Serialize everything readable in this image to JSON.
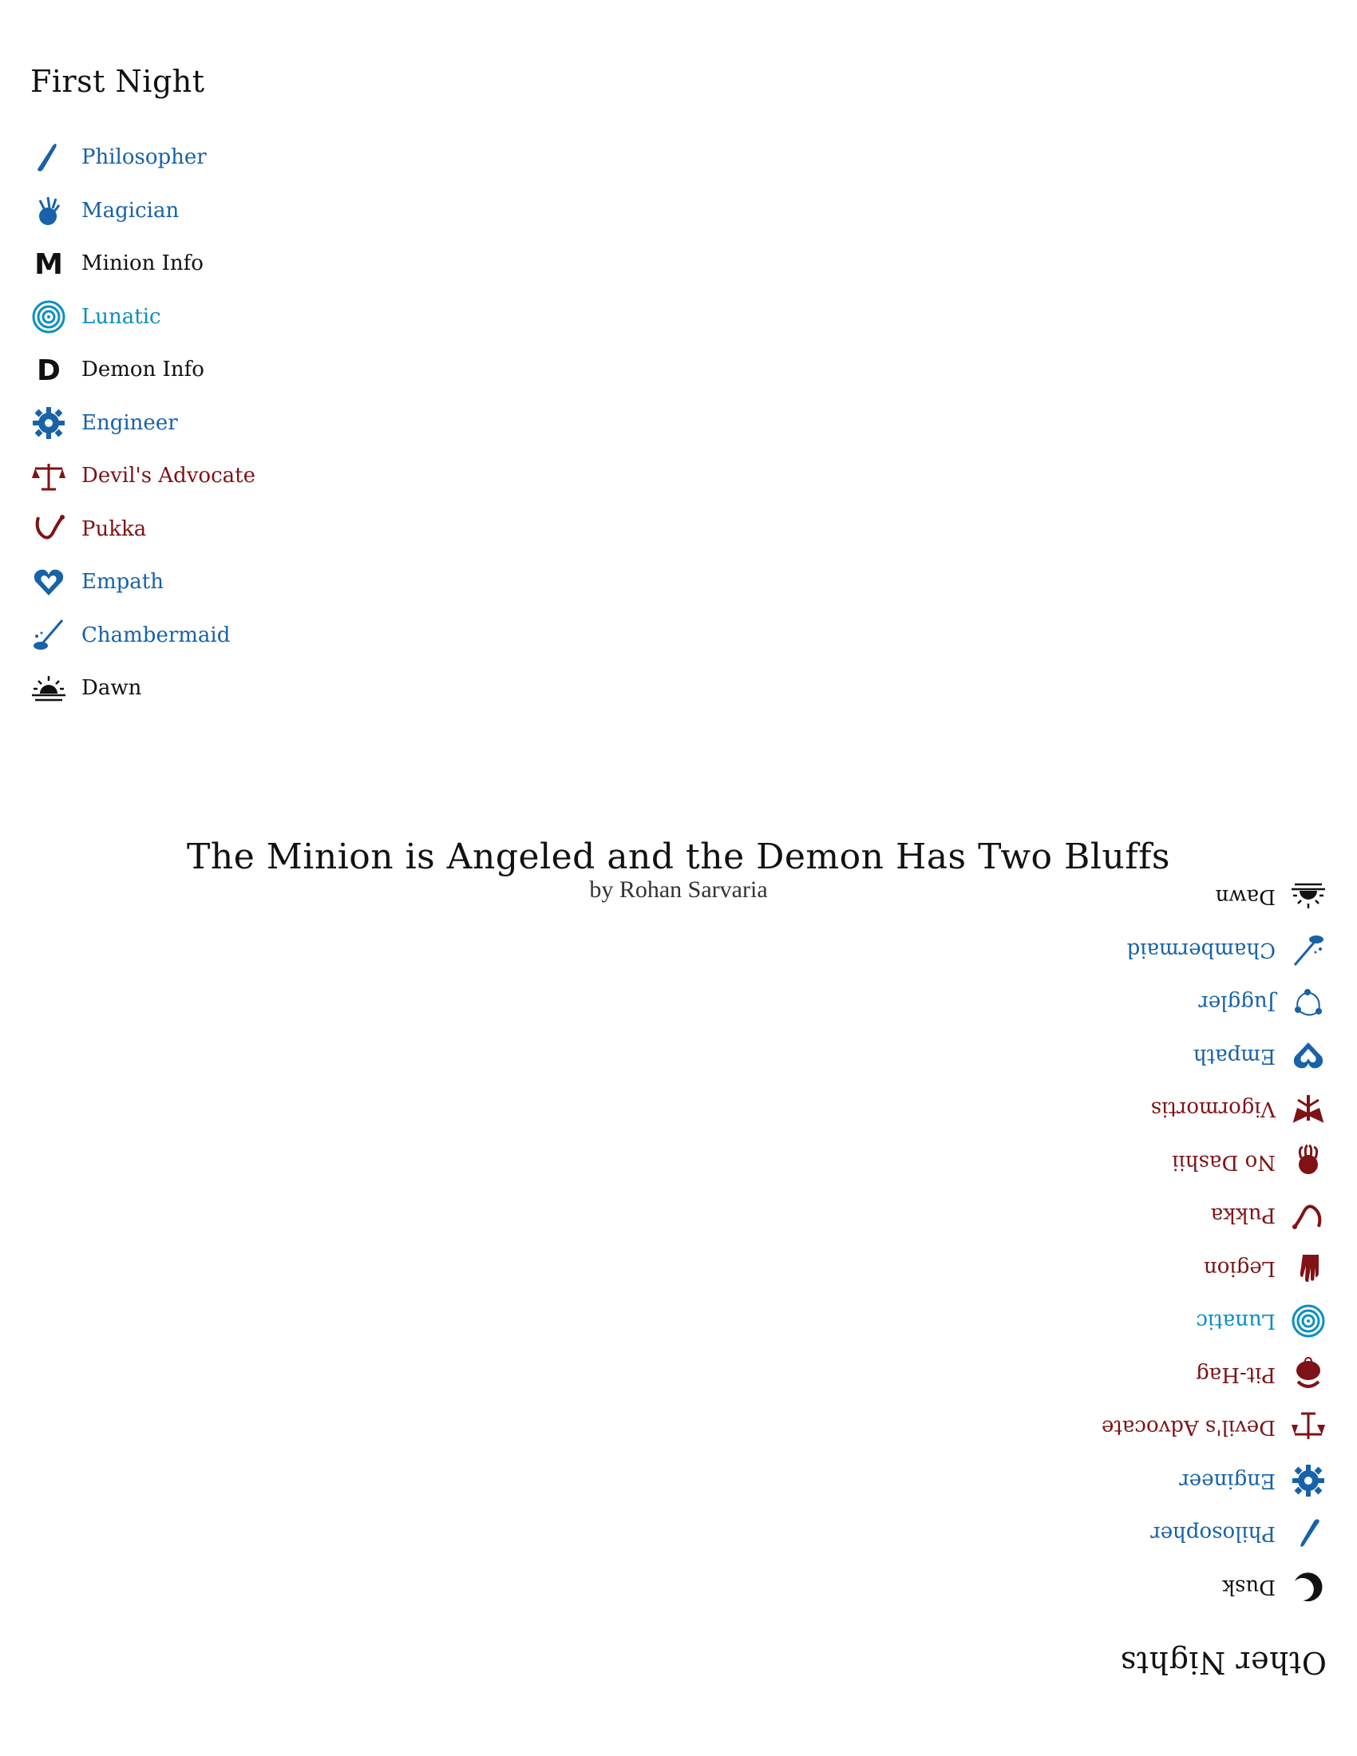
{
  "first_night": {
    "heading": "First Night",
    "items": [
      {
        "label": "Philosopher",
        "icon": "philosopher-icon",
        "team": "townsfolk"
      },
      {
        "label": "Magician",
        "icon": "magician-icon",
        "team": "townsfolk"
      },
      {
        "label": "Minion Info",
        "icon": "minion-info-icon",
        "team": "neutral"
      },
      {
        "label": "Lunatic",
        "icon": "lunatic-icon",
        "team": "outsider"
      },
      {
        "label": "Demon Info",
        "icon": "demon-info-icon",
        "team": "neutral"
      },
      {
        "label": "Engineer",
        "icon": "engineer-icon",
        "team": "townsfolk"
      },
      {
        "label": "Devil's Advocate",
        "icon": "devils-advocate-icon",
        "team": "evil"
      },
      {
        "label": "Pukka",
        "icon": "pukka-icon",
        "team": "evil"
      },
      {
        "label": "Empath",
        "icon": "empath-icon",
        "team": "townsfolk"
      },
      {
        "label": "Chambermaid",
        "icon": "chambermaid-icon",
        "team": "townsfolk"
      },
      {
        "label": "Dawn",
        "icon": "dawn-icon",
        "team": "neutral"
      }
    ]
  },
  "script": {
    "title": "The Minion is Angeled and the Demon Has Two Bluffs",
    "author": "by Rohan Sarvaria"
  },
  "other_nights": {
    "heading": "Other Nights",
    "items": [
      {
        "label": "Dusk",
        "icon": "dusk-icon",
        "team": "neutral"
      },
      {
        "label": "Philosopher",
        "icon": "philosopher-icon",
        "team": "townsfolk"
      },
      {
        "label": "Engineer",
        "icon": "engineer-icon",
        "team": "townsfolk"
      },
      {
        "label": "Devil's Advocate",
        "icon": "devils-advocate-icon",
        "team": "evil"
      },
      {
        "label": "Pit-Hag",
        "icon": "pit-hag-icon",
        "team": "evil"
      },
      {
        "label": "Lunatic",
        "icon": "lunatic-icon",
        "team": "outsider"
      },
      {
        "label": "Legion",
        "icon": "legion-icon",
        "team": "evil"
      },
      {
        "label": "Pukka",
        "icon": "pukka-icon",
        "team": "evil"
      },
      {
        "label": "No Dashii",
        "icon": "no-dashii-icon",
        "team": "evil"
      },
      {
        "label": "Vigormortis",
        "icon": "vigormortis-icon",
        "team": "evil"
      },
      {
        "label": "Empath",
        "icon": "empath-icon",
        "team": "townsfolk"
      },
      {
        "label": "Juggler",
        "icon": "juggler-icon",
        "team": "townsfolk"
      },
      {
        "label": "Chambermaid",
        "icon": "chambermaid-icon",
        "team": "townsfolk"
      },
      {
        "label": "Dawn",
        "icon": "dawn-icon",
        "team": "neutral"
      }
    ]
  },
  "colors": {
    "townsfolk": "#1762a8",
    "outsider": "#0a8fbf",
    "evil": "#7f1216",
    "neutral": "#111111"
  }
}
